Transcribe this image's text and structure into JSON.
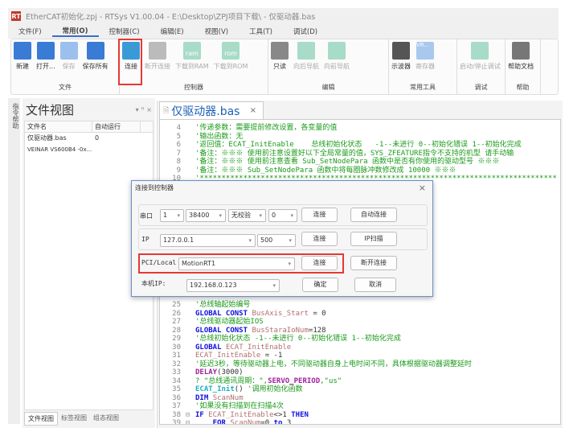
{
  "title": "EtherCAT初始化.zpj - RTSys V1.00.04 - E:\\Desktop\\ZPJ项目下载\\ - 仅驱动器.bas",
  "logo": "RT",
  "menu": [
    "文件(F)",
    "常用(O)",
    "控制器(C)",
    "编辑(E)",
    "视图(V)",
    "工具(T)",
    "调试(D)"
  ],
  "ribbon": {
    "file": {
      "label": "文件",
      "buttons": [
        "新建",
        "打开...",
        "保存",
        "保存所有"
      ]
    },
    "controller": {
      "label": "控制器",
      "buttons": [
        "连接",
        "断开连接",
        "下载到RAM",
        "下载到ROM"
      ],
      "ram": "ram",
      "rom": "rom"
    },
    "edit": {
      "label": "编辑",
      "buttons": [
        "只读",
        "向后导航",
        "向前导航"
      ]
    },
    "tools": {
      "label": "常用工具",
      "buttons": [
        "示波器",
        "寄存器"
      ],
      "vr": "VR..."
    },
    "debug": {
      "label": "调试",
      "buttons": [
        "启动/停止调试"
      ]
    },
    "help": {
      "label": "帮助",
      "buttons": [
        "帮助文档"
      ]
    }
  },
  "left_strip": "指令帮助",
  "panel": {
    "title": "文件视图",
    "headers": [
      "文件名",
      "自动运行"
    ],
    "rows": [
      [
        "仅驱动器.bas",
        "0"
      ],
      [
        "VEINAR VS600B4 -0x...",
        ""
      ]
    ],
    "tabs": [
      "文件视图",
      "标签视图",
      "组态视图"
    ]
  },
  "editor": {
    "tab": "仅驱动器.bas",
    "lines_top": [
      {
        "n": "4",
        "s": [
          [
            "'传递参数：需要提前修改设置，各变量的值",
            "c"
          ]
        ]
      },
      {
        "n": "5",
        "s": [
          [
            "'输出函数：无",
            "c"
          ]
        ]
      },
      {
        "n": "6",
        "s": [
          [
            "'返回值：ECAT_InitEnable    总线初始化状态   -1--未进行 0--初始化错误 1--初始化完成",
            "c"
          ]
        ]
      },
      {
        "n": "7",
        "s": [
          [
            "'备注：※※※ 使用前注意设置好以下全局常量的值，SYS_ZFEATURE指令不支持的机型 请手动输",
            "c"
          ]
        ]
      },
      {
        "n": "8",
        "s": [
          [
            "'备注：※※※ 使用前注意查看 Sub_SetNodePara 函数中是否有你使用的驱动型号 ※※※",
            "c"
          ]
        ]
      },
      {
        "n": "9",
        "s": [
          [
            "'备注：※※※ Sub_SetNodePara 函数中将每圈脉冲数修改成 10000 ※※※",
            "c"
          ]
        ]
      },
      {
        "n": "10",
        "s": [
          [
            "'**********************************************************************************",
            "c"
          ]
        ]
      }
    ],
    "lines_bottom": [
      {
        "n": "25",
        "s": [
          [
            "'总线轴起始编号",
            "c"
          ]
        ]
      },
      {
        "n": "26",
        "s": [
          [
            "GLOBAL CONST ",
            "k"
          ],
          [
            "BusAxis_Start",
            "v"
          ],
          [
            " = 0",
            "n"
          ]
        ]
      },
      {
        "n": "27",
        "s": [
          [
            "'总线驱动器起始IOS",
            "c"
          ]
        ]
      },
      {
        "n": "28",
        "s": [
          [
            "GLOBAL CONST ",
            "k"
          ],
          [
            "BusStaraIoNum",
            "v"
          ],
          [
            "=128",
            "n"
          ]
        ]
      },
      {
        "n": "29",
        "s": [
          [
            "'总线初始化状态 -1--未进行 0--初始化错误 1--初始化完成",
            "c"
          ]
        ]
      },
      {
        "n": "30",
        "s": [
          [
            "GLOBAL ",
            "k"
          ],
          [
            "ECAT_InitEnable",
            "v"
          ]
        ]
      },
      {
        "n": "31",
        "s": [
          [
            "ECAT_InitEnable",
            "v"
          ],
          [
            " = -1",
            "n"
          ]
        ]
      },
      {
        "n": "32",
        "s": [
          [
            "'延迟3秒，等待驱动器上电，不同驱动器自身上电时间不同，具体根据驱动器调整延时",
            "c"
          ]
        ]
      },
      {
        "n": "33",
        "s": [
          [
            "DELAY",
            "p"
          ],
          [
            "(3000)",
            "n"
          ]
        ]
      },
      {
        "n": "34",
        "s": [
          [
            "? \"总线通讯周期：\",",
            "c"
          ],
          [
            "SERVO_PERIOD",
            "p"
          ],
          [
            ",\"us\"",
            "c"
          ]
        ]
      },
      {
        "n": "35",
        "s": [
          [
            "ECAT_Init",
            "f"
          ],
          [
            "() ",
            "n"
          ],
          [
            "'调用初始化函数",
            "c"
          ]
        ]
      },
      {
        "n": "36",
        "s": [
          [
            "DIM ",
            "k"
          ],
          [
            "ScanNum",
            "v"
          ]
        ]
      },
      {
        "n": "37",
        "s": [
          [
            "'如果没有扫描到在扫描4次",
            "c"
          ]
        ]
      },
      {
        "n": "38",
        "fold": "⊟",
        "s": [
          [
            "IF ",
            "k"
          ],
          [
            "ECAT_InitEnable",
            "v"
          ],
          [
            "<>1 ",
            "n"
          ],
          [
            "THEN",
            "k"
          ]
        ]
      },
      {
        "n": "39",
        "fold": "⊟",
        "s": [
          [
            "    FOR ",
            "k"
          ],
          [
            "ScanNum",
            "v"
          ],
          [
            "=0 ",
            "n"
          ],
          [
            "to",
            "k"
          ],
          [
            " 3",
            "n"
          ]
        ]
      }
    ]
  },
  "dialog": {
    "title": "连接到控制器",
    "close": "×",
    "serial": {
      "label": "串口",
      "port": "1",
      "baud": "38400",
      "parity": "无校验",
      "stop": "0",
      "connect": "连接",
      "auto": "自动连接"
    },
    "ip": {
      "label": "IP",
      "address": "127.0.0.1",
      "port": "500",
      "connect": "连接",
      "scan": "IP扫描"
    },
    "pci": {
      "label": "PCI/Local",
      "value": "MotionRT1",
      "connect": "连接",
      "disconnect": "断开连接"
    },
    "local": {
      "label": "本机IP:",
      "value": "192.168.0.123",
      "ok": "确定",
      "cancel": "取消"
    }
  },
  "colors": {
    "highlight": "#e53935",
    "comment": "#1a9a1a",
    "keyword": "#1010e0",
    "accent": "#1e5fb4"
  }
}
